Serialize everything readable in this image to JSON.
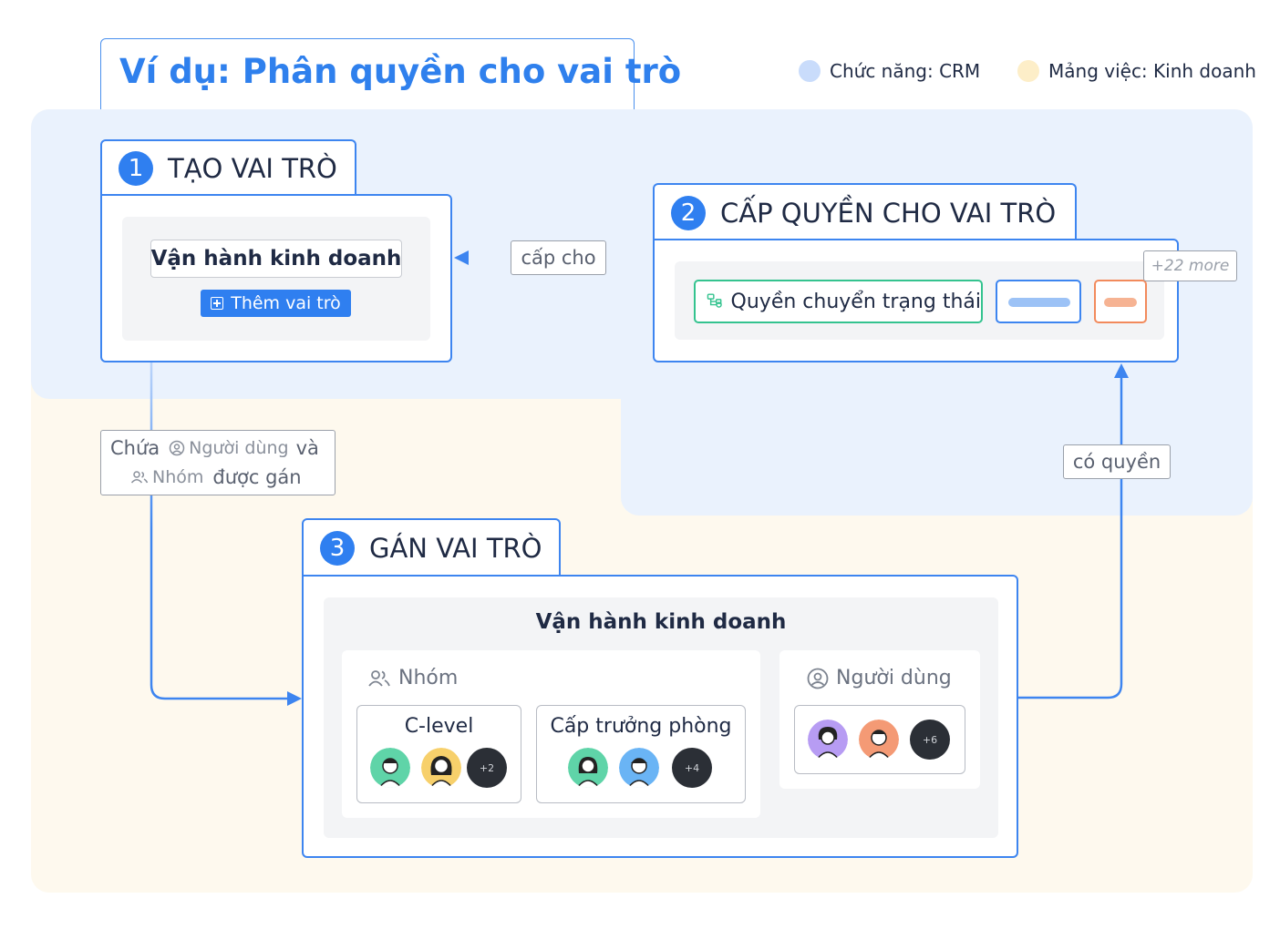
{
  "title": "Ví dụ: Phân quyền cho vai trò",
  "legend": [
    {
      "label": "Chức năng: CRM",
      "color": "#c9dcfb"
    },
    {
      "label": "Mảng việc: Kinh doanh",
      "color": "#fdeec8"
    }
  ],
  "step1": {
    "number": "1",
    "label": "TẠO VAI TRÒ",
    "role_name": "Vận hành kinh doanh",
    "add_button": "Thêm vai trò"
  },
  "step2": {
    "number": "2",
    "label": "CẤP QUYỀN CHO VAI TRÒ",
    "permission": "Quyền chuyển trạng thái",
    "more": "+22 more"
  },
  "step3": {
    "number": "3",
    "label": "GÁN VAI TRÒ",
    "role_name": "Vận hành kinh doanh",
    "groups_header": "Nhóm",
    "users_header": "Người dùng",
    "groups": [
      {
        "name": "C-level",
        "more": "+2"
      },
      {
        "name": "Cấp trưởng phòng",
        "more": "+4"
      }
    ],
    "users_more": "+6"
  },
  "edges": {
    "grant": "cấp cho",
    "has_permission": "có quyền",
    "contains_prefix": "Chứa",
    "contains_users": "Người dùng",
    "contains_and": "và",
    "contains_groups": "Nhóm",
    "contains_suffix": "được gán"
  }
}
